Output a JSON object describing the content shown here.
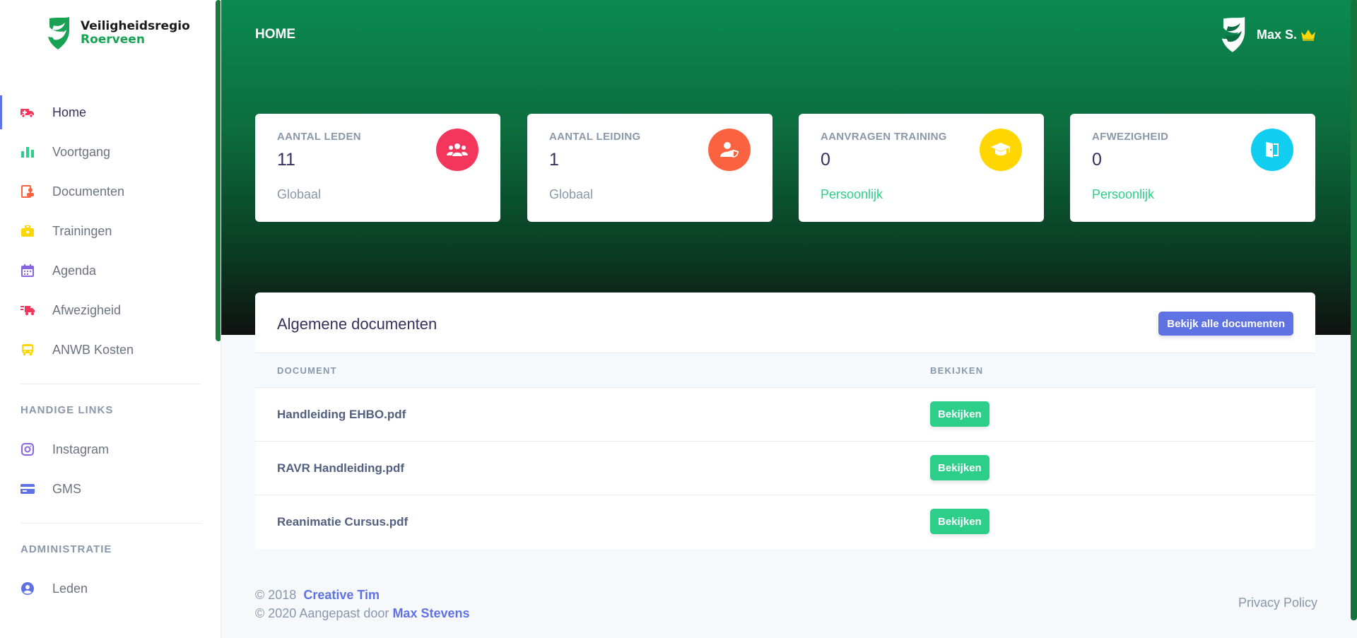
{
  "brand": {
    "line1": "Veiligheidsregio",
    "line2": "Roerveen"
  },
  "sidebar": {
    "items": [
      {
        "label": "Home",
        "icon": "ambulance-icon",
        "color": "#f5365c",
        "active": true
      },
      {
        "label": "Voortgang",
        "icon": "bar-chart-icon",
        "color": "#2dce89"
      },
      {
        "label": "Documenten",
        "icon": "document-user-icon",
        "color": "#fb6340"
      },
      {
        "label": "Trainingen",
        "icon": "briefcase-icon",
        "color": "#ffd600"
      },
      {
        "label": "Agenda",
        "icon": "calendar-icon",
        "color": "#8965e0"
      },
      {
        "label": "Afwezigheid",
        "icon": "fast-truck-icon",
        "color": "#f5365c"
      },
      {
        "label": "ANWB Kosten",
        "icon": "bus-icon",
        "color": "#ffd600"
      }
    ],
    "links_heading": "HANDIGE LINKS",
    "links": [
      {
        "label": "Instagram",
        "icon": "instagram-icon",
        "color": "#8965e0"
      },
      {
        "label": "GMS",
        "icon": "card-icon",
        "color": "#5e72e4"
      }
    ],
    "admin_heading": "ADMINISTRATIE",
    "admin": [
      {
        "label": "Leden",
        "icon": "user-circle-icon",
        "color": "#5e72e4"
      }
    ]
  },
  "header": {
    "title": "HOME",
    "user_name": "Max S."
  },
  "stats": [
    {
      "title": "AANTAL LEDEN",
      "value": "11",
      "foot": "Globaal",
      "icon": "users-icon",
      "color": "#f5365c"
    },
    {
      "title": "AANTAL LEIDING",
      "value": "1",
      "foot": "Globaal",
      "icon": "user-shield-icon",
      "color": "#fb6340"
    },
    {
      "title": "AANVRAGEN TRAINING",
      "value": "0",
      "foot": "Persoonlijk",
      "icon": "graduation-cap-icon",
      "color": "#ffd600"
    },
    {
      "title": "AFWEZIGHEID",
      "value": "0",
      "foot": "Persoonlijk",
      "icon": "door-icon",
      "color": "#11cdef"
    }
  ],
  "documents": {
    "title": "Algemene documenten",
    "view_all": "Bekijk alle documenten",
    "columns": [
      "DOCUMENT",
      "BEKIJKEN"
    ],
    "rows": [
      {
        "name": "Handleiding EHBO.pdf",
        "action": "Bekijken"
      },
      {
        "name": "RAVR Handleiding.pdf",
        "action": "Bekijken"
      },
      {
        "name": "Reanimatie Cursus.pdf",
        "action": "Bekijken"
      }
    ]
  },
  "footer": {
    "line1_prefix": "© 2018",
    "line1_link": "Creative Tim",
    "line2_prefix": "© 2020 Aangepast door",
    "line2_link": "Max Stevens",
    "privacy": "Privacy Policy"
  },
  "colors": {
    "brand_green": "#19a254",
    "primary": "#5e72e4",
    "success": "#2dce89"
  }
}
